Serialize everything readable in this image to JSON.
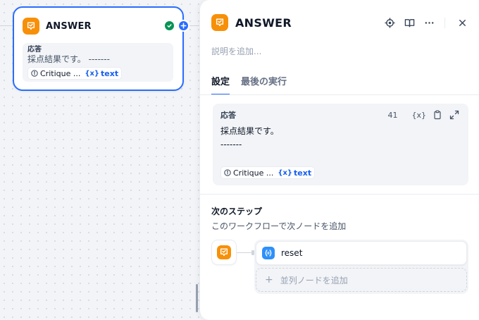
{
  "node": {
    "title": "ANSWER",
    "label": "応答",
    "text": "採点結果です。 -------",
    "chip_source": "Critique ...",
    "chip_var_icon": "{x}",
    "chip_var": "text",
    "status": "success",
    "icons": [
      "answer-icon",
      "check-circle-icon",
      "plus-icon",
      "info-icon"
    ]
  },
  "panel": {
    "title": "ANSWER",
    "description_placeholder": "説明を追加...",
    "tabs": [
      "設定",
      "最後の実行"
    ],
    "active_tab": "設定",
    "toolbar_icons": [
      "locate-icon",
      "book-icon",
      "more-icon",
      "close-icon"
    ],
    "response": {
      "label": "応答",
      "char_count": "41",
      "var_button": "{x}",
      "line1": "採点結果です。",
      "line2": "-------",
      "chip_source": "Critique ...",
      "chip_var_icon": "{x}",
      "chip_var": "text",
      "icons": [
        "clipboard-icon",
        "expand-icon"
      ]
    },
    "next_step": {
      "title": "次のステップ",
      "description": "このワークフローで次ノードを追加",
      "items": [
        {
          "label": "reset",
          "icon": "variable-assigner-icon"
        }
      ],
      "add_parallel_plus": "+",
      "add_parallel_label": "並列ノードを追加"
    }
  },
  "colors": {
    "accent": "#296dff",
    "answer_icon": "#f79009",
    "success": "#079455",
    "var_icon": "#2e90fa",
    "variable_text": "#155eef"
  }
}
